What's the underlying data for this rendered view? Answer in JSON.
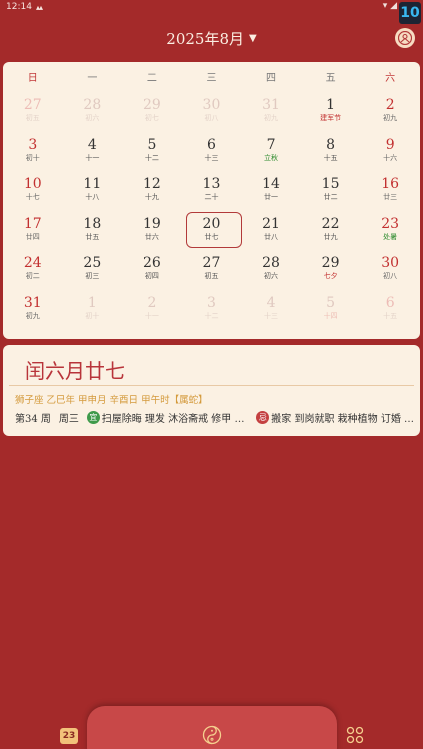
{
  "status": {
    "time": "12:14",
    "signal": "▴▴",
    "right_icons": "▾ ◢",
    "badge": "10"
  },
  "header": {
    "month_label": "2025年8月",
    "caret": "▼"
  },
  "weekdays": [
    "日",
    "一",
    "二",
    "三",
    "四",
    "五",
    "六"
  ],
  "weeks": [
    [
      [
        "27",
        "初五",
        1,
        ""
      ],
      [
        "28",
        "初六",
        1,
        ""
      ],
      [
        "29",
        "初七",
        1,
        ""
      ],
      [
        "30",
        "初八",
        1,
        ""
      ],
      [
        "31",
        "初九",
        1,
        ""
      ],
      [
        "1",
        "建军节",
        0,
        "fest"
      ],
      [
        "2",
        "初九",
        0,
        ""
      ]
    ],
    [
      [
        "3",
        "初十",
        0,
        ""
      ],
      [
        "4",
        "十一",
        0,
        ""
      ],
      [
        "5",
        "十二",
        0,
        ""
      ],
      [
        "6",
        "十三",
        0,
        ""
      ],
      [
        "7",
        "立秋",
        0,
        "term"
      ],
      [
        "8",
        "十五",
        0,
        ""
      ],
      [
        "9",
        "十六",
        0,
        ""
      ]
    ],
    [
      [
        "10",
        "十七",
        0,
        ""
      ],
      [
        "11",
        "十八",
        0,
        ""
      ],
      [
        "12",
        "十九",
        0,
        ""
      ],
      [
        "13",
        "二十",
        0,
        ""
      ],
      [
        "14",
        "廿一",
        0,
        ""
      ],
      [
        "15",
        "廿二",
        0,
        ""
      ],
      [
        "16",
        "廿三",
        0,
        ""
      ]
    ],
    [
      [
        "17",
        "廿四",
        0,
        ""
      ],
      [
        "18",
        "廿五",
        0,
        ""
      ],
      [
        "19",
        "廿六",
        0,
        ""
      ],
      [
        "20",
        "廿七",
        0,
        "today"
      ],
      [
        "21",
        "廿八",
        0,
        ""
      ],
      [
        "22",
        "廿九",
        0,
        ""
      ],
      [
        "23",
        "处暑",
        0,
        "term"
      ]
    ],
    [
      [
        "24",
        "初二",
        0,
        ""
      ],
      [
        "25",
        "初三",
        0,
        ""
      ],
      [
        "26",
        "初四",
        0,
        ""
      ],
      [
        "27",
        "初五",
        0,
        ""
      ],
      [
        "28",
        "初六",
        0,
        ""
      ],
      [
        "29",
        "七夕",
        0,
        "fest"
      ],
      [
        "30",
        "初八",
        0,
        ""
      ]
    ],
    [
      [
        "31",
        "初九",
        0,
        ""
      ],
      [
        "1",
        "初十",
        1,
        ""
      ],
      [
        "2",
        "十一",
        1,
        ""
      ],
      [
        "3",
        "十二",
        1,
        ""
      ],
      [
        "4",
        "十三",
        1,
        ""
      ],
      [
        "5",
        "十四",
        1,
        "dimfest"
      ],
      [
        "6",
        "十五",
        1,
        ""
      ]
    ]
  ],
  "info": {
    "lunar_date": "闰六月廿七",
    "ganzhi": "狮子座 乙巳年 甲申月 辛酉日 甲午时【属蛇】",
    "week_no": "第34 周",
    "weekday": "周三",
    "yi_badge": "宜",
    "yi_text": "扫屋除晦 理发 沐浴斋戒 修甲 …",
    "ji_badge": "忌",
    "ji_text": "搬家 到岗就职 栽种植物 订婚 …"
  },
  "nav": {
    "calendar_day": "23"
  },
  "colors": {
    "background": "#a42a2a",
    "card": "#fbf1e3",
    "accent_red": "#c23030",
    "accent_gold": "#d49a3c",
    "term_green": "#2e8b2e"
  }
}
